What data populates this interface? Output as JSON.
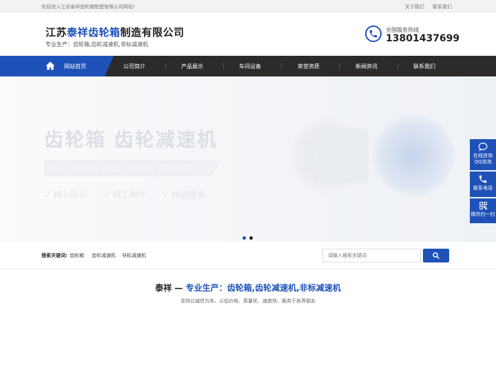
{
  "topbar": {
    "welcome": "欢迎进入江苏泰祥齿轮箱制造有限公司网站!",
    "links": [
      "关于我们",
      "联系我们"
    ]
  },
  "header": {
    "title_prefix": "江苏",
    "title_highlight": "泰祥齿轮箱",
    "title_suffix": "制造有限公司",
    "subtitle": "专业生产：齿轮箱,齿轮减速机,非标减速机",
    "hotline_label": "全国服务热线",
    "hotline_number": "13801437699"
  },
  "nav": {
    "home": "网站首页",
    "items": [
      "公司简介",
      "产品展示",
      "车间设备",
      "荣誉资质",
      "新闻资讯",
      "联系我们"
    ]
  },
  "banner": {
    "slogan": "齿轮箱  齿轮减速机",
    "industries": "发电 / 冶金 / 矿山 / 造船 / 石油化工",
    "features": [
      "精心设计",
      "精工制作",
      "精诚服务"
    ],
    "active_slide": 1,
    "slide_count": 2
  },
  "search": {
    "label": "搜索关键词:",
    "keywords": [
      "齿轮箱",
      "齿轮减速机",
      "非标减速机"
    ],
    "placeholder": "请输入搜索关键词"
  },
  "section": {
    "title_brand": "泰祥 —",
    "title_text": "专业生产：齿轮箱,齿轮减速机,非标减速机",
    "subtitle": "坚持以诚信为本、以低价格、质量优、速度快、服务于各界朋友"
  },
  "sidebar": [
    {
      "label1": "在线咨询",
      "label2": "QQ咨询",
      "icon": "chat-icon"
    },
    {
      "label1": "联系电话",
      "label2": "",
      "icon": "phone-icon"
    },
    {
      "label1": "微信扫一扫",
      "label2": "",
      "icon": "qrcode-icon"
    }
  ],
  "colors": {
    "brand": "#1f52b8",
    "nav_bg": "#2b2b2b"
  }
}
